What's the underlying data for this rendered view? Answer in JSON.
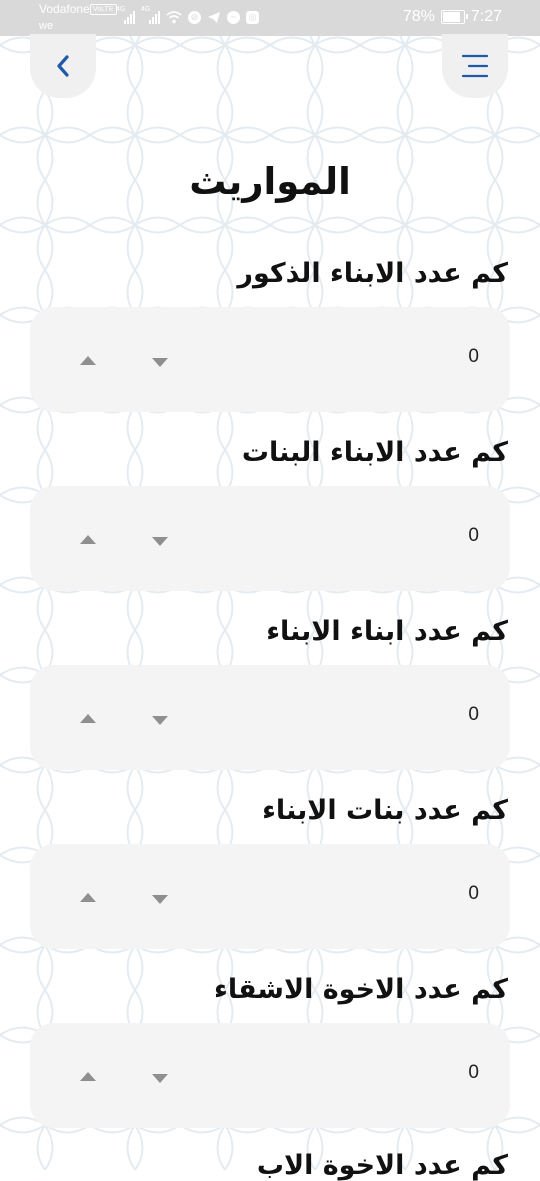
{
  "status_bar": {
    "carrier": "Vodafone",
    "carrier_line2": "we",
    "volte": "VoLTE",
    "net1": "4G",
    "net2": "4G",
    "battery": "78%",
    "time": "7:27"
  },
  "header": {
    "back_icon": "chevron-left-icon",
    "menu_icon": "menu-icon",
    "accent_color": "#1e5aa8"
  },
  "page": {
    "title": "المواريث"
  },
  "questions": [
    {
      "label": "كم عدد الابناء الذكور",
      "value": "0"
    },
    {
      "label": "كم عدد الابناء البنات",
      "value": "0"
    },
    {
      "label": "كم عدد ابناء الابناء",
      "value": "0"
    },
    {
      "label": "كم عدد بنات الابناء",
      "value": "0"
    },
    {
      "label": "كم عدد الاخوة الاشقاء",
      "value": "0"
    },
    {
      "label": "كم عدد الاخوة الاب"
    }
  ]
}
